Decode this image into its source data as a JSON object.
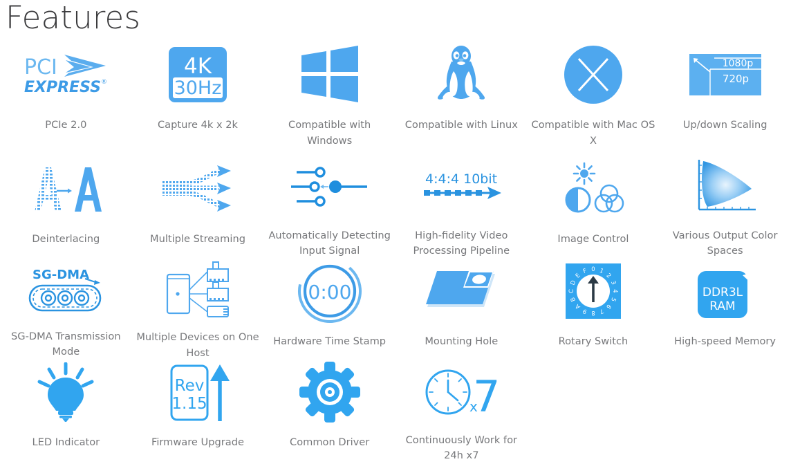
{
  "page": {
    "title": "Features",
    "accent_color": "#4ea7ee",
    "accent_dark": "#3d9be6",
    "caption_color": "#77787b",
    "title_color": "#3a3a3c",
    "background_color": "#ffffff"
  },
  "features": [
    {
      "id": "pcie-2-0",
      "icon": "pci-express-logo-icon",
      "label": "PCIe 2.0",
      "icon_text": [
        "PCI",
        "EXPRESS"
      ]
    },
    {
      "id": "capture-4k",
      "icon": "4k-30hz-badge-icon",
      "label": "Capture 4k x 2k",
      "icon_text": [
        "4K",
        "30Hz"
      ]
    },
    {
      "id": "compatible-windows",
      "icon": "windows-logo-icon",
      "label": "Compatible with Windows",
      "icon_text": []
    },
    {
      "id": "compatible-linux",
      "icon": "linux-penguin-icon",
      "label": "Compatible with Linux",
      "icon_text": []
    },
    {
      "id": "compatible-macosx",
      "icon": "mac-os-x-circle-icon",
      "label": "Compatible with Mac OS X",
      "icon_text": [
        "X"
      ]
    },
    {
      "id": "up-down-scaling",
      "icon": "resolution-scaling-icon",
      "label": "Up/down Scaling",
      "icon_text": [
        "1080p",
        "720p"
      ]
    },
    {
      "id": "deinterlacing",
      "icon": "deinterlacing-letter-a-icon",
      "label": "Deinterlacing",
      "icon_text": [
        "A",
        "A"
      ]
    },
    {
      "id": "multiple-streaming",
      "icon": "multiple-streaming-arrows-icon",
      "label": "Multiple Streaming",
      "icon_text": []
    },
    {
      "id": "auto-detect-input",
      "icon": "sliders-auto-detect-icon",
      "label": "Automatically Detecting Input Signal",
      "icon_text": []
    },
    {
      "id": "high-fidelity-pipeline",
      "icon": "444-10bit-pipeline-icon",
      "label": "High-fidelity Video Processing Pipeline",
      "icon_text": [
        "4:4:4 10bit"
      ]
    },
    {
      "id": "image-control",
      "icon": "brightness-color-wheels-icon",
      "label": "Image Control",
      "icon_text": []
    },
    {
      "id": "color-spaces",
      "icon": "chromaticity-gamut-icon",
      "label": "Various Output Color Spaces",
      "icon_text": []
    },
    {
      "id": "sg-dma",
      "icon": "sg-dma-gears-icon",
      "label": "SG-DMA Transmission Mode",
      "icon_text": [
        "SG-DMA"
      ]
    },
    {
      "id": "multiple-devices",
      "icon": "multiple-devices-host-icon",
      "label": "Multiple Devices on One Host",
      "icon_text": []
    },
    {
      "id": "hardware-time-stamp",
      "icon": "stopwatch-timer-icon",
      "label": "Hardware Time Stamp",
      "icon_text": [
        "0:00"
      ]
    },
    {
      "id": "mounting-hole",
      "icon": "mounting-hole-plate-icon",
      "label": "Mounting Hole",
      "icon_text": []
    },
    {
      "id": "rotary-switch",
      "icon": "rotary-switch-dial-icon",
      "label": "Rotary Switch",
      "icon_text": [
        "0",
        "1",
        "2",
        "3",
        "4",
        "5",
        "6",
        "7",
        "8",
        "9",
        "A",
        "B",
        "C",
        "D",
        "E",
        "F"
      ]
    },
    {
      "id": "high-speed-memory",
      "icon": "ddr3l-ram-chip-icon",
      "label": "High-speed Memory",
      "icon_text": [
        "DDR3L",
        "RAM"
      ]
    },
    {
      "id": "led-indicator",
      "icon": "light-bulb-icon",
      "label": "LED Indicator",
      "icon_text": []
    },
    {
      "id": "firmware-upgrade",
      "icon": "firmware-rev-arrow-icon",
      "label": "Firmware Upgrade",
      "icon_text": [
        "Rev",
        "1.15"
      ]
    },
    {
      "id": "common-driver",
      "icon": "gear-cog-icon",
      "label": "Common Driver",
      "icon_text": []
    },
    {
      "id": "continuous-work",
      "icon": "clock-x7-icon",
      "label": "Continuously Work for 24h x7",
      "icon_text": [
        "x7"
      ]
    }
  ]
}
